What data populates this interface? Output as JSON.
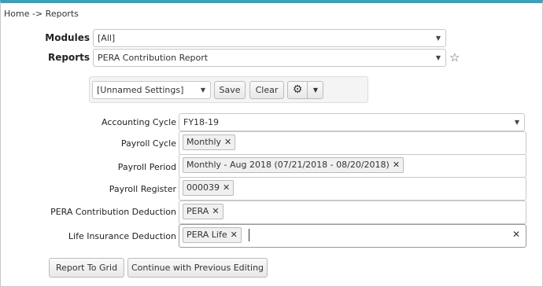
{
  "breadcrumb": "Home -> Reports",
  "modules": {
    "label": "Modules",
    "value": "[All]"
  },
  "reports": {
    "label": "Reports",
    "value": "PERA Contribution Report"
  },
  "settings": {
    "value": "[Unnamed Settings]",
    "save_label": "Save",
    "clear_label": "Clear"
  },
  "fields": {
    "accounting_cycle": {
      "label": "Accounting Cycle",
      "value": "FY18-19"
    },
    "payroll_cycle": {
      "label": "Payroll Cycle",
      "tags": [
        "Monthly"
      ]
    },
    "payroll_period": {
      "label": "Payroll Period",
      "tags": [
        "Monthly - Aug 2018 (07/21/2018 - 08/20/2018)"
      ]
    },
    "payroll_register": {
      "label": "Payroll Register",
      "tags": [
        "000039"
      ]
    },
    "pera_contribution": {
      "label": "PERA Contribution Deduction",
      "tags": [
        "PERA"
      ]
    },
    "life_insurance": {
      "label": "Life Insurance Deduction",
      "tags": [
        "PERA Life"
      ]
    }
  },
  "actions": {
    "report_to_grid": "Report To Grid",
    "continue_editing": "Continue with Previous Editing"
  },
  "glyphs": {
    "remove": "✕",
    "caret": "▼",
    "star": "☆",
    "gear": "⚙"
  },
  "colors": {
    "accent": "#2fa4c4"
  }
}
